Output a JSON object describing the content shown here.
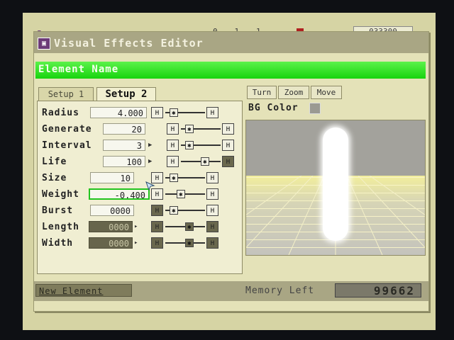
{
  "topstrip": {
    "item1": "▪",
    "item2": "0 . 1 . 1",
    "counter": "033300"
  },
  "window": {
    "title": "Visual Effects Editor",
    "title_icon": "▣"
  },
  "section": {
    "title": "Element Name"
  },
  "tabs": [
    {
      "label": "Setup 1"
    },
    {
      "label": "Setup 2"
    }
  ],
  "params": [
    {
      "label": "Radius",
      "value": "4.000",
      "style": "light"
    },
    {
      "label": "Generate",
      "value": "20",
      "style": "light"
    },
    {
      "label": "Interval",
      "value": "3",
      "style": "light"
    },
    {
      "label": "Life",
      "value": "100",
      "style": "light"
    },
    {
      "label": "Size",
      "value": "10",
      "style": "light"
    },
    {
      "label": "Weight",
      "value": "-0.400",
      "style": "selected"
    },
    {
      "label": "Burst",
      "value": "0000",
      "style": "light"
    },
    {
      "label": "Length",
      "value": "0000",
      "style": "dark"
    },
    {
      "label": "Width",
      "value": "0000",
      "style": "dark"
    }
  ],
  "view_tabs": [
    {
      "label": "Turn"
    },
    {
      "label": "Zoom"
    },
    {
      "label": "Move"
    }
  ],
  "bg_color": {
    "label": "BG Color",
    "swatch": "#9b9a92"
  },
  "status": {
    "new_element": "New Element",
    "memory_label": "Memory Left",
    "memory_value": "99662"
  },
  "colors": {
    "accent_green": "#17d40e",
    "panel": "#f0eed2",
    "chrome": "#a9a684"
  }
}
